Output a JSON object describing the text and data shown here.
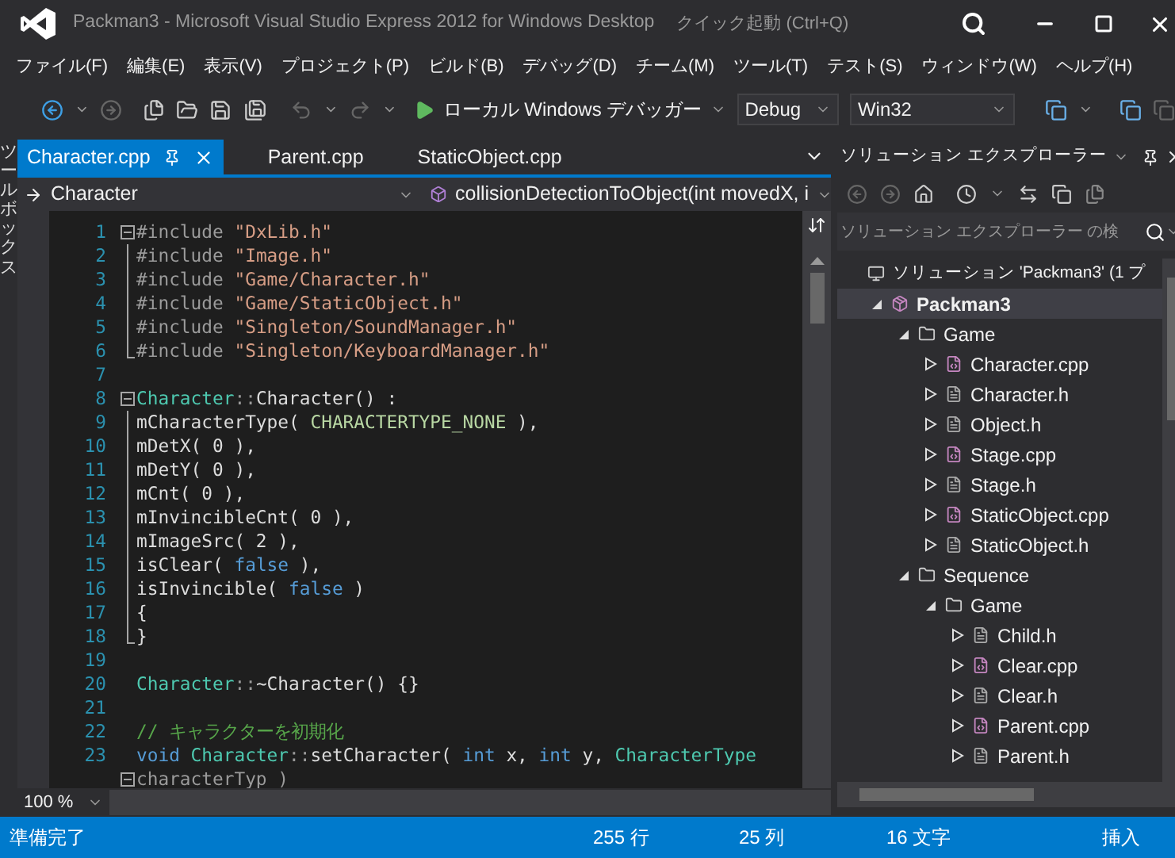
{
  "window": {
    "title": "Packman3 - Microsoft Visual Studio Express 2012 for Windows Desktop",
    "quick_launch": {
      "placeholder": "クイック起動 (Ctrl+Q)"
    }
  },
  "menu": [
    "ファイル(F)",
    "編集(E)",
    "表示(V)",
    "プロジェクト(P)",
    "ビルド(B)",
    "デバッグ(D)",
    "チーム(M)",
    "ツール(T)",
    "テスト(S)",
    "ウィンドウ(W)",
    "ヘルプ(H)"
  ],
  "toolbar": {
    "debugger": "ローカル Windows デバッガー",
    "configuration": "Debug",
    "platform": "Win32"
  },
  "toolbox": {
    "label": "ツールボックス"
  },
  "tabs": [
    {
      "label": "Character.cpp",
      "selected": true
    },
    {
      "label": "Parent.cpp",
      "selected": false
    },
    {
      "label": "StaticObject.cpp",
      "selected": false
    }
  ],
  "nav_bar": {
    "scope": "Character",
    "member": "collisionDetectionToObject(int movedX, i"
  },
  "code": [
    {
      "number": "1",
      "kind": "fold_start",
      "tokens": [
        {
          "t": "#include ",
          "kind": "preprocessor"
        },
        {
          "t": "\"DxLib.h\"",
          "kind": "string"
        }
      ]
    },
    {
      "number": "2",
      "kind": "fold_inner",
      "tokens": [
        {
          "t": "#include ",
          "kind": "preprocessor"
        },
        {
          "t": "\"Image.h\"",
          "kind": "string"
        }
      ]
    },
    {
      "number": "3",
      "kind": "fold_inner",
      "tokens": [
        {
          "t": "#include ",
          "kind": "preprocessor"
        },
        {
          "t": "\"Game/Character.h\"",
          "kind": "string"
        }
      ]
    },
    {
      "number": "4",
      "kind": "fold_inner",
      "tokens": [
        {
          "t": "#include ",
          "kind": "preprocessor"
        },
        {
          "t": "\"Game/StaticObject.h\"",
          "kind": "string"
        }
      ]
    },
    {
      "number": "5",
      "kind": "fold_inner",
      "tokens": [
        {
          "t": "#include ",
          "kind": "preprocessor"
        },
        {
          "t": "\"Singleton/SoundManager.h\"",
          "kind": "string"
        }
      ]
    },
    {
      "number": "6",
      "kind": "fold_end",
      "tokens": [
        {
          "t": "#include ",
          "kind": "preprocessor"
        },
        {
          "t": "\"Singleton/KeyboardManager.h\"",
          "kind": "string"
        }
      ]
    },
    {
      "number": "7",
      "kind": "plain"
    },
    {
      "number": "8",
      "kind": "fold_start",
      "tokens": [
        {
          "t": "Character",
          "kind": "type"
        },
        {
          "t": "::",
          "kind": "punct"
        },
        {
          "t": "Character() :",
          "kind": "plain"
        }
      ]
    },
    {
      "number": "9",
      "kind": "fold_inner",
      "tokens": [
        {
          "t": "mCharacterType( ",
          "kind": "plain"
        },
        {
          "t": "CHARACTERTYPE_NONE",
          "kind": "macro"
        },
        {
          "t": " ),",
          "kind": "plain"
        }
      ]
    },
    {
      "number": "10",
      "kind": "fold_inner",
      "tokens": [
        {
          "t": "mDetX( 0 ),",
          "kind": "plain"
        }
      ]
    },
    {
      "number": "11",
      "kind": "fold_inner",
      "tokens": [
        {
          "t": "mDetY( 0 ),",
          "kind": "plain"
        }
      ]
    },
    {
      "number": "12",
      "kind": "fold_inner",
      "tokens": [
        {
          "t": "mCnt( 0 ),",
          "kind": "plain"
        }
      ]
    },
    {
      "number": "13",
      "kind": "fold_inner",
      "tokens": [
        {
          "t": "mInvincibleCnt( 0 ),",
          "kind": "plain"
        }
      ]
    },
    {
      "number": "14",
      "kind": "fold_inner",
      "tokens": [
        {
          "t": "mImageSrc( 2 ),",
          "kind": "plain"
        }
      ]
    },
    {
      "number": "15",
      "kind": "fold_inner",
      "tokens": [
        {
          "t": "isClear( ",
          "kind": "plain"
        },
        {
          "t": "false",
          "kind": "keyword"
        },
        {
          "t": " ),",
          "kind": "plain"
        }
      ]
    },
    {
      "number": "16",
      "kind": "fold_inner",
      "tokens": [
        {
          "t": "isInvincible( ",
          "kind": "plain"
        },
        {
          "t": "false",
          "kind": "keyword"
        },
        {
          "t": " )",
          "kind": "plain"
        }
      ]
    },
    {
      "number": "17",
      "kind": "fold_inner",
      "tokens": [
        {
          "t": "{",
          "kind": "plain"
        }
      ]
    },
    {
      "number": "18",
      "kind": "fold_end",
      "tokens": [
        {
          "t": "}",
          "kind": "plain"
        }
      ]
    },
    {
      "number": "19",
      "kind": "plain"
    },
    {
      "number": "20",
      "kind": "plain",
      "tokens": [
        {
          "t": "Character",
          "kind": "type"
        },
        {
          "t": "::",
          "kind": "punct"
        },
        {
          "t": "~Character() {}",
          "kind": "plain"
        }
      ]
    },
    {
      "number": "21",
      "kind": "plain"
    },
    {
      "number": "22",
      "kind": "plain",
      "tokens": [
        {
          "t": "// キャラクターを初期化",
          "kind": "comment"
        }
      ]
    },
    {
      "number": "23",
      "kind": "plain",
      "tokens": [
        {
          "t": "void ",
          "kind": "keyword"
        },
        {
          "t": "Character",
          "kind": "type"
        },
        {
          "t": "::",
          "kind": "punct"
        },
        {
          "t": "setCharacter( ",
          "kind": "plain"
        },
        {
          "t": "int",
          "kind": "keyword"
        },
        {
          "t": " x, ",
          "kind": "plain"
        },
        {
          "t": "int",
          "kind": "keyword"
        },
        {
          "t": " y, ",
          "kind": "plain"
        },
        {
          "t": "CharacterType",
          "kind": "type"
        }
      ]
    },
    {
      "kind": "fold_start",
      "tokens": [
        {
          "t": "characterTyp )",
          "kind": "preprocessor"
        }
      ]
    }
  ],
  "zoom": "100 %",
  "solution_explorer": {
    "title": "ソリューション エクスプローラー",
    "search": {
      "placeholder": "ソリューション エクスプローラー の検"
    },
    "tree": [
      {
        "label": "ソリューション 'Packman3' (1 プ",
        "kind": "solution",
        "selected": false,
        "children": [
          {
            "label": "Packman3",
            "kind": "project",
            "expanded": true,
            "selected": true,
            "children": [
              {
                "label": "Game",
                "kind": "folder",
                "expanded": true,
                "selected": false,
                "children": [
                  {
                    "label": "Character.cpp",
                    "kind": "cpp",
                    "expanded": false,
                    "selected": false
                  },
                  {
                    "label": "Character.h",
                    "kind": "h",
                    "expanded": false,
                    "selected": false
                  },
                  {
                    "label": "Object.h",
                    "kind": "h",
                    "expanded": false,
                    "selected": false
                  },
                  {
                    "label": "Stage.cpp",
                    "kind": "cpp",
                    "expanded": false,
                    "selected": false
                  },
                  {
                    "label": "Stage.h",
                    "kind": "h",
                    "expanded": false,
                    "selected": false
                  },
                  {
                    "label": "StaticObject.cpp",
                    "kind": "cpp",
                    "expanded": false,
                    "selected": false
                  },
                  {
                    "label": "StaticObject.h",
                    "kind": "h",
                    "expanded": false,
                    "selected": false
                  }
                ]
              },
              {
                "label": "Sequence",
                "kind": "folder",
                "expanded": true,
                "selected": false,
                "children": [
                  {
                    "label": "Game",
                    "kind": "folder",
                    "expanded": true,
                    "selected": false,
                    "children": [
                      {
                        "label": "Child.h",
                        "kind": "h",
                        "expanded": false,
                        "selected": false
                      },
                      {
                        "label": "Clear.cpp",
                        "kind": "cpp",
                        "expanded": false,
                        "selected": false
                      },
                      {
                        "label": "Clear.h",
                        "kind": "h",
                        "expanded": false,
                        "selected": false
                      },
                      {
                        "label": "Parent.cpp",
                        "kind": "cpp",
                        "expanded": false,
                        "selected": false
                      },
                      {
                        "label": "Parent.h",
                        "kind": "h",
                        "expanded": false,
                        "selected": false
                      }
                    ]
                  }
                ]
              }
            ]
          }
        ]
      }
    ]
  },
  "status_bar": {
    "message": "準備完了",
    "line": "255 行",
    "column": "25 列",
    "chars": "16 文字",
    "mode": "挿入"
  }
}
